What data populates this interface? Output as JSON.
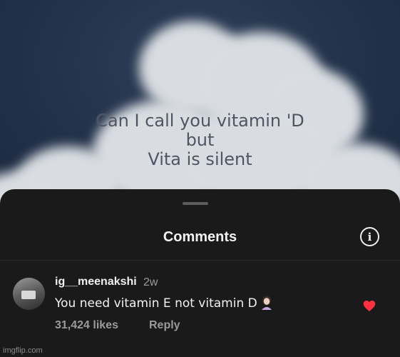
{
  "video": {
    "caption_lines": [
      "Can I call you vitamin 'D",
      "but",
      "Vita is silent"
    ]
  },
  "sheet": {
    "title": "Comments",
    "info_icon": "info-icon"
  },
  "comment": {
    "username": "ig__meenakshi",
    "time": "2w",
    "text": "You need vitamin E not vitamin D",
    "emoji": "woman-facepalming",
    "likes": "31,424 likes",
    "reply_label": "Reply",
    "liked": true,
    "heart_color": "#ff3040"
  },
  "watermark": "imgflip.com"
}
